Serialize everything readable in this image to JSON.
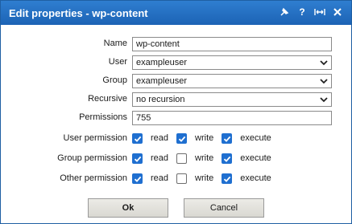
{
  "dialog": {
    "title": "Edit properties - wp-content"
  },
  "form": {
    "name": {
      "label": "Name",
      "value": "wp-content"
    },
    "user": {
      "label": "User",
      "value": "exampleuser"
    },
    "group": {
      "label": "Group",
      "value": "exampleuser"
    },
    "recursive": {
      "label": "Recursive",
      "value": "no recursion"
    },
    "permissions": {
      "label": "Permissions",
      "value": "755"
    }
  },
  "perms": {
    "read_label": "read",
    "write_label": "write",
    "execute_label": "execute",
    "user": {
      "label": "User permission",
      "read": true,
      "write": true,
      "execute": true
    },
    "group": {
      "label": "Group permission",
      "read": true,
      "write": false,
      "execute": true
    },
    "other": {
      "label": "Other permission",
      "read": true,
      "write": false,
      "execute": true
    }
  },
  "buttons": {
    "ok": "Ok",
    "cancel": "Cancel"
  },
  "icons": {
    "pin": "pin-icon",
    "help": "help-icon",
    "maximize": "maximize-icon",
    "close": "close-icon"
  },
  "colors": {
    "titlebar": "#1f6fd0",
    "checkbox_checked": "#1f6fd0"
  }
}
